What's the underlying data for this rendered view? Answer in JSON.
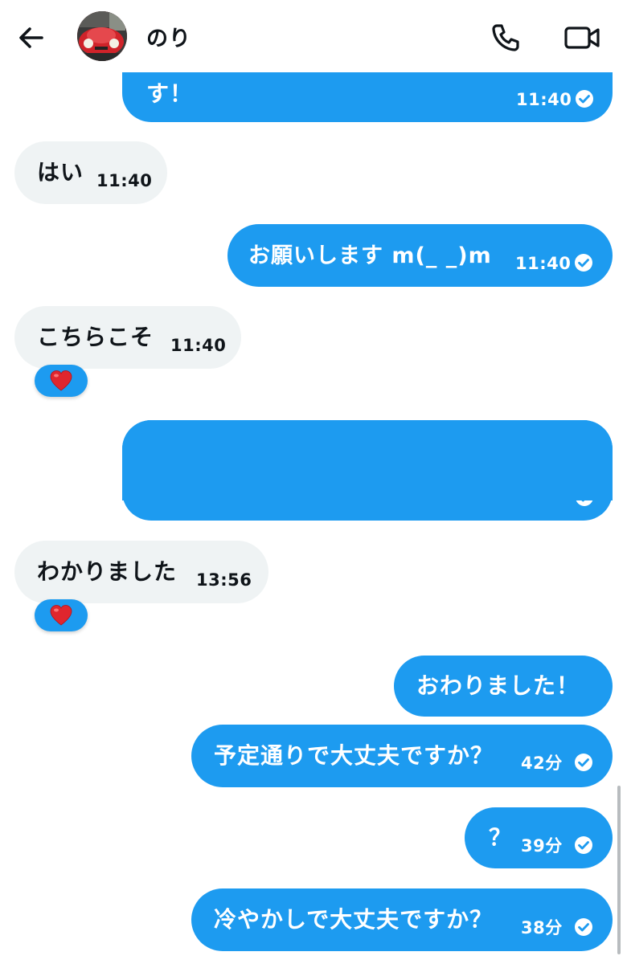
{
  "header": {
    "contact_name": "のり",
    "back_icon": "arrow-left-icon",
    "call_icon": "phone-icon",
    "video_icon": "video-camera-icon"
  },
  "colors": {
    "sent_bubble": "#1d9bf0",
    "received_bubble": "#eff3f4",
    "reaction_bg": "#1d9bf0",
    "heart": "#e0262e",
    "text_dark": "#0f1419"
  },
  "messages": [
    {
      "direction": "sent",
      "text": "す！",
      "time": "11:40",
      "read": true
    },
    {
      "direction": "received",
      "text": "はい",
      "time": "11:40"
    },
    {
      "direction": "sent",
      "text": "お願いします m(_ _)m",
      "time": "11:40",
      "read": true
    },
    {
      "direction": "received",
      "text": "こちらこそ",
      "time": "11:40",
      "reaction": "heart"
    },
    {
      "direction": "sent",
      "text": "",
      "time": "",
      "read": true,
      "redacted": true
    },
    {
      "direction": "received",
      "text": "わかりました",
      "time": "13:56",
      "reaction": "heart"
    },
    {
      "direction": "sent",
      "text": "おわりました！",
      "time": ""
    },
    {
      "direction": "sent",
      "text": "予定通りで大丈夫ですか？",
      "time": "42分",
      "read": true
    },
    {
      "direction": "sent",
      "text": "？",
      "time": "39分",
      "read": true
    },
    {
      "direction": "sent",
      "text": "冷やかしで大丈夫ですか？",
      "time": "38分",
      "read": true
    }
  ]
}
